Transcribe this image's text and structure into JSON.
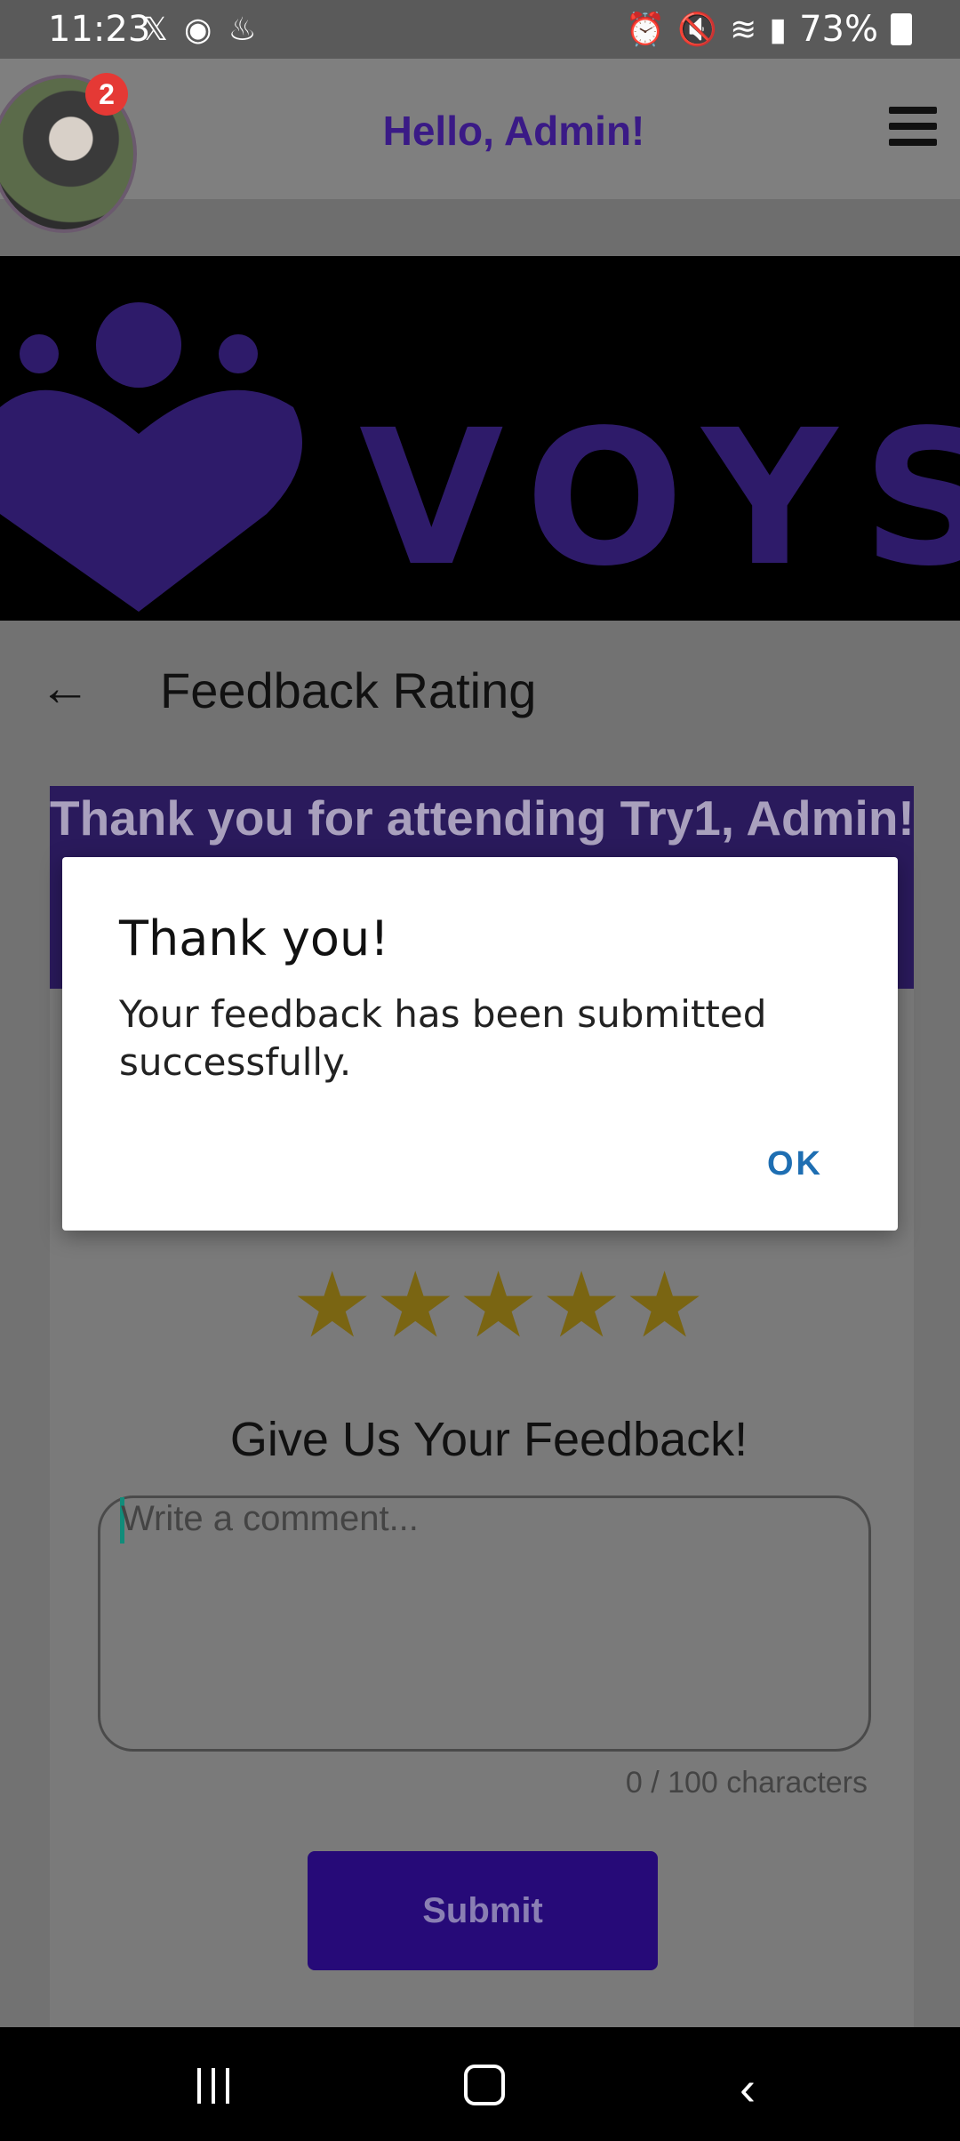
{
  "status_bar": {
    "time": "11:23",
    "left_icons": [
      "x-icon",
      "messenger-icon",
      "notification-icon"
    ],
    "right_icons": [
      "alarm-icon",
      "mute-icon",
      "wifi-icon",
      "volte-icon",
      "signal-icon"
    ],
    "battery_percent": "73%"
  },
  "header": {
    "greeting": "Hello, Admin!",
    "notification_count": "2"
  },
  "banner": {
    "brand": "VOYS"
  },
  "page": {
    "title": "Feedback Rating"
  },
  "card": {
    "thank_text": "Thank you for attending Try1, Admin!",
    "rating": 5,
    "stars": [
      "★",
      "★",
      "★",
      "★",
      "★"
    ],
    "feedback_title": "Give Us Your Feedback!",
    "comment_placeholder": "Write a comment...",
    "char_count": "0 / 100 characters",
    "submit_label": "Submit"
  },
  "dialog": {
    "title": "Thank you!",
    "message": "Your feedback has been submitted successfully.",
    "ok_label": "OK"
  },
  "colors": {
    "brand_purple": "#3a1a86",
    "submit_bg": "#260a78",
    "star": "#7a6512",
    "dialog_ok": "#1e6eb2",
    "badge": "#e53935"
  }
}
